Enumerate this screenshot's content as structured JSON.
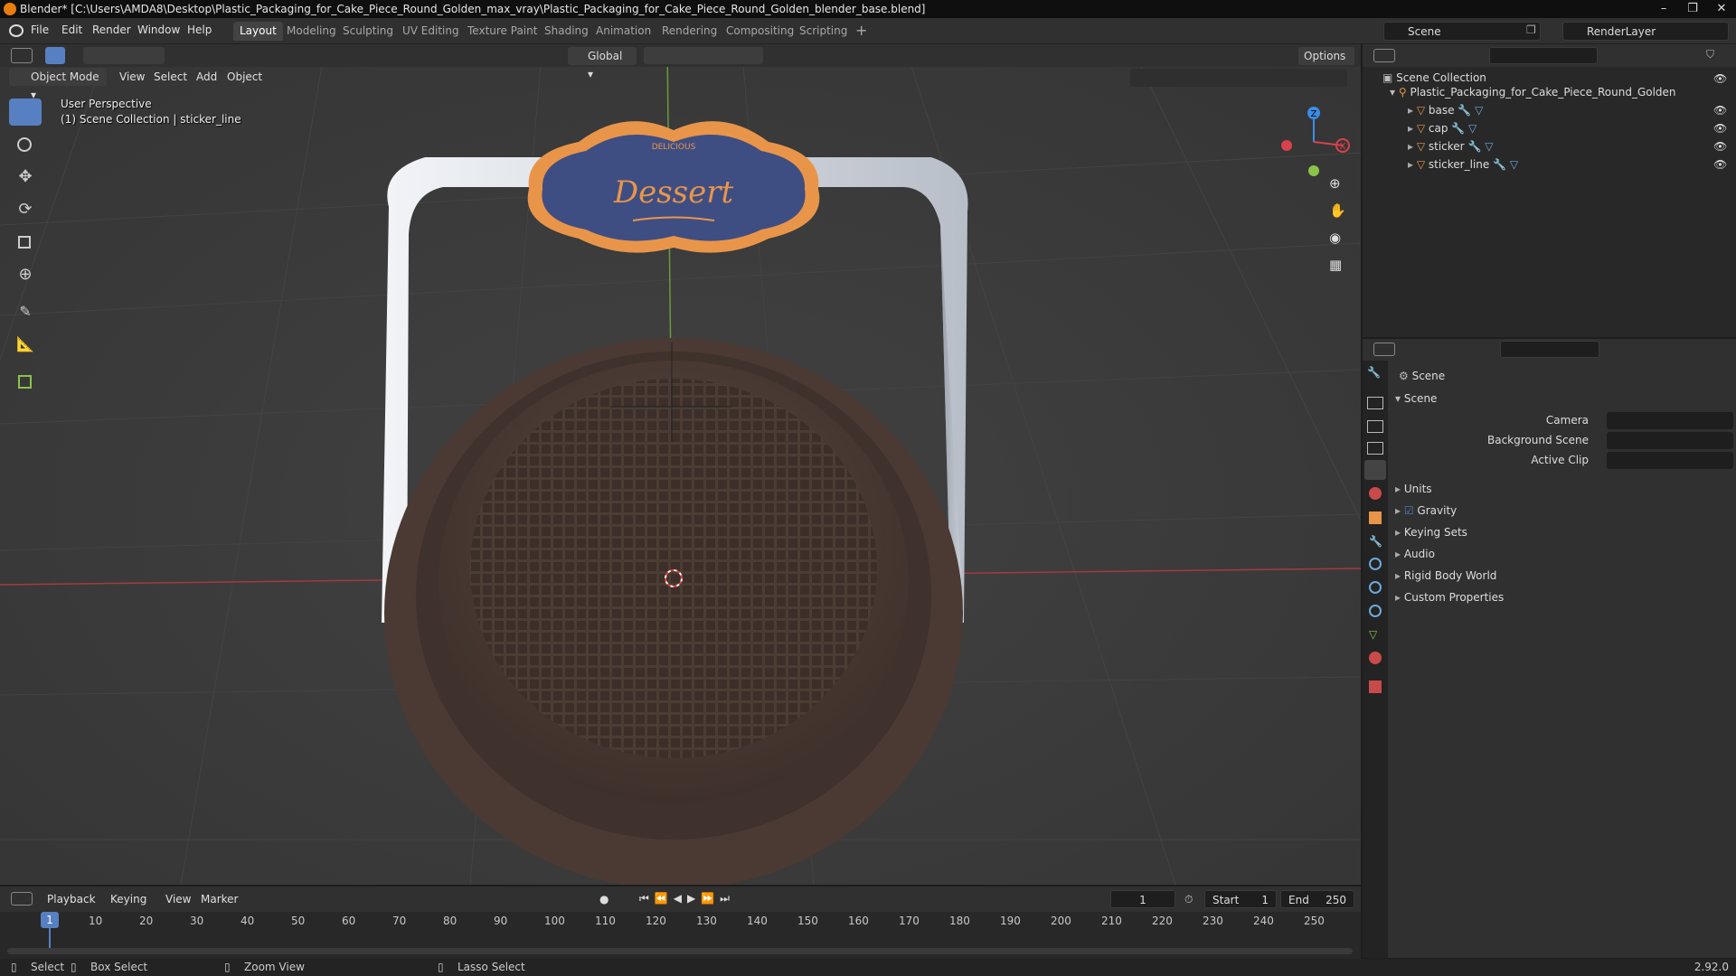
{
  "titlebar": {
    "text": "Blender* [C:\\Users\\AMDA8\\Desktop\\Plastic_Packaging_for_Cake_Piece_Round_Golden_max_vray\\Plastic_Packaging_for_Cake_Piece_Round_Golden_blender_base.blend]"
  },
  "menu": {
    "file": "File",
    "edit": "Edit",
    "render": "Render",
    "window": "Window",
    "help": "Help"
  },
  "workspaces": [
    "Layout",
    "Modeling",
    "Sculpting",
    "UV Editing",
    "Texture Paint",
    "Shading",
    "Animation",
    "Rendering",
    "Compositing",
    "Scripting"
  ],
  "active_workspace": "Layout",
  "scene_field": "Scene",
  "viewlayer_field": "RenderLayer",
  "viewport": {
    "transform_orientation": "Global",
    "options": "Options",
    "mode": "Object Mode",
    "menu_view": "View",
    "menu_select": "Select",
    "menu_add": "Add",
    "menu_object": "Object",
    "overlay_title": "User Perspective",
    "overlay_sub": "(1) Scene Collection | sticker_line",
    "sticker_small": "DELICIOUS",
    "sticker_text": "Dessert"
  },
  "outliner": {
    "root": "Scene Collection",
    "collection": "Plastic_Packaging_for_Cake_Piece_Round_Golden",
    "items": [
      "base",
      "cap",
      "sticker",
      "sticker_line"
    ]
  },
  "properties": {
    "context": "Scene",
    "section": "Scene",
    "camera_label": "Camera",
    "bg_scene_label": "Background Scene",
    "active_clip_label": "Active Clip",
    "panels": [
      "Units",
      "Gravity",
      "Keying Sets",
      "Audio",
      "Rigid Body World",
      "Custom Properties"
    ],
    "gravity_checked": true
  },
  "timeline": {
    "playback": "Playback",
    "keying": "Keying",
    "view": "View",
    "marker": "Marker",
    "current_frame": "1",
    "start_label": "Start",
    "start": "1",
    "end_label": "End",
    "end": "250",
    "ticks": [
      "10",
      "20",
      "30",
      "40",
      "50",
      "60",
      "70",
      "80",
      "90",
      "100",
      "110",
      "120",
      "130",
      "140",
      "150",
      "160",
      "170",
      "180",
      "190",
      "200",
      "210",
      "220",
      "230",
      "240",
      "250"
    ],
    "current_tick": "1"
  },
  "status": {
    "select": "Select",
    "box_select": "Box Select",
    "zoom_view": "Zoom View",
    "lasso_select": "Lasso Select",
    "version": "2.92.0"
  },
  "colors": {
    "accent": "#5680c2",
    "orange": "#e87d0d",
    "axis_x": "#d9414c",
    "axis_y": "#8bc34a",
    "axis_z": "#3a8ee6"
  }
}
